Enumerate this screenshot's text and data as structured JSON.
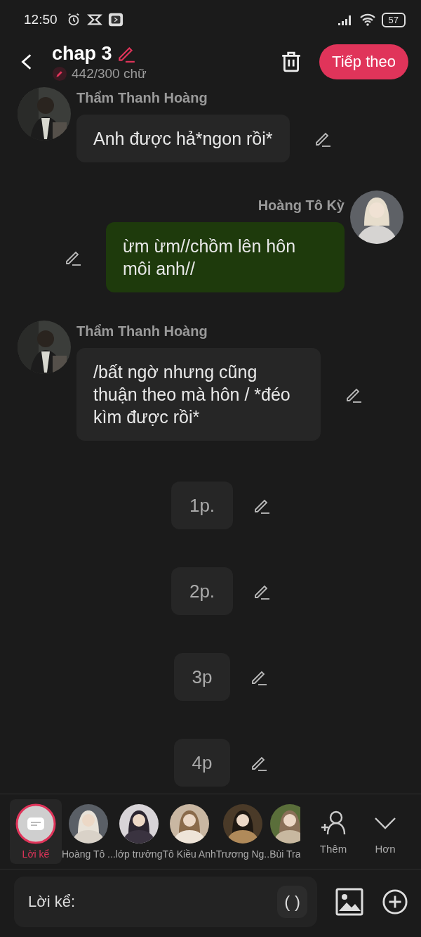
{
  "status_bar": {
    "time": "12:50",
    "battery": "57"
  },
  "header": {
    "title": "chap 3",
    "word_count": "442/300 chữ",
    "next_button": "Tiếp theo"
  },
  "messages": [
    {
      "kind": "left",
      "sender": "Thẩm Thanh Hoàng",
      "text": "Anh được hả*ngon rồi*"
    },
    {
      "kind": "right",
      "sender": "Hoàng Tô Kỳ",
      "text": "ừm ừm//chồm lên hôn môi anh//"
    },
    {
      "kind": "left",
      "sender": "Thẩm Thanh Hoàng",
      "text": "/bất ngờ nhưng cũng thuận theo mà hôn / *đéo kìm được rồi*"
    },
    {
      "kind": "narration",
      "text": "1p."
    },
    {
      "kind": "narration",
      "text": "2p."
    },
    {
      "kind": "narration",
      "text": "3p"
    },
    {
      "kind": "narration",
      "text": "4p"
    }
  ],
  "characters": [
    {
      "kind": "narrator",
      "name": "Lời kể",
      "selected": true
    },
    {
      "kind": "avatar",
      "name": "Hoàng Tô ...",
      "selected": false
    },
    {
      "kind": "avatar",
      "name": "lớp trưởng",
      "selected": false
    },
    {
      "kind": "avatar",
      "name": "Tô Kiều Anh",
      "selected": false
    },
    {
      "kind": "avatar",
      "name": "Trương Ng..",
      "selected": false
    },
    {
      "kind": "avatar",
      "name": "Bùi Tra",
      "selected": false
    }
  ],
  "actions": [
    {
      "kind": "add",
      "label": "Thêm"
    },
    {
      "kind": "more",
      "label": "Hơn"
    }
  ],
  "input": {
    "placeholder": "Lời kể:",
    "bracket_button": "( )"
  }
}
